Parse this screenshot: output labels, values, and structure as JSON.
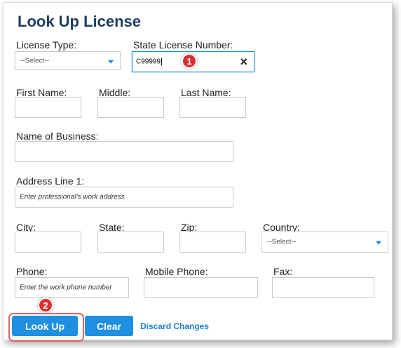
{
  "title": "Look Up License",
  "fields": {
    "license_type": {
      "label": "License Type:",
      "value": "--Select--"
    },
    "state_license_number": {
      "label": "State License Number:",
      "value": "C99999"
    },
    "first_name": {
      "label": "First Name:"
    },
    "middle": {
      "label": "Middle:"
    },
    "last_name": {
      "label": "Last Name:"
    },
    "business": {
      "label": "Name of Business:"
    },
    "address1": {
      "label": "Address Line 1:",
      "placeholder": "Enter professional's work address"
    },
    "city": {
      "label": "City:"
    },
    "state": {
      "label": "State:"
    },
    "zip": {
      "label": "Zip:"
    },
    "country": {
      "label": "Country:",
      "value": "--Select--"
    },
    "phone": {
      "label": "Phone:",
      "placeholder": "Enter the work phone number"
    },
    "mobile_phone": {
      "label": "Mobile Phone:"
    },
    "fax": {
      "label": "Fax:"
    }
  },
  "clear_icon": "×",
  "badges": {
    "one": "1",
    "two": "2"
  },
  "buttons": {
    "lookup": "Look Up",
    "clear": "Clear",
    "discard": "Discard Changes"
  },
  "colors": {
    "title": "#1f3c64",
    "primary": "#1e8fe1",
    "badge": "#e02e2e"
  }
}
